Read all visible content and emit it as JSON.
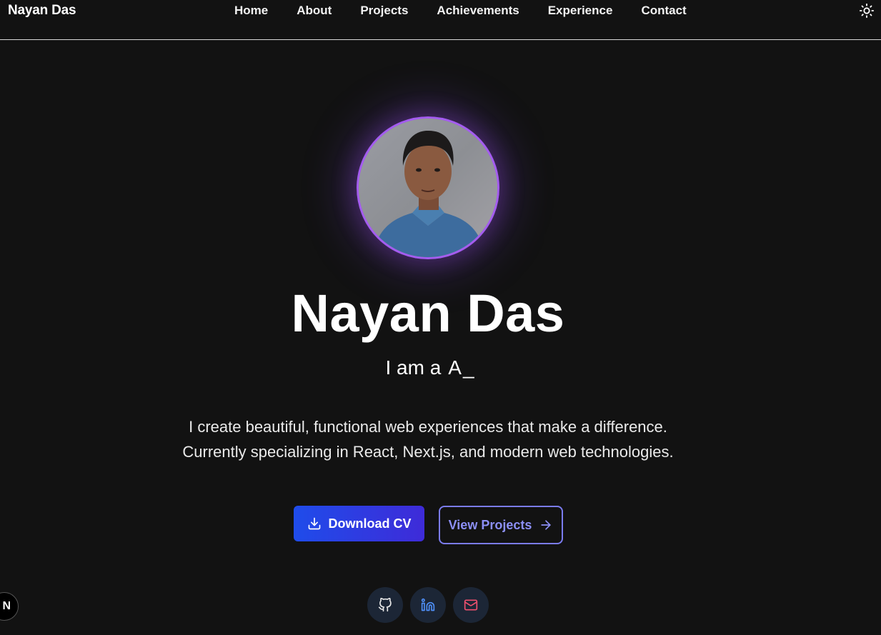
{
  "nav": {
    "brand": "Nayan Das",
    "links": [
      "Home",
      "About",
      "Projects",
      "Achievements",
      "Experience",
      "Contact"
    ],
    "theme_icon": "sun-icon"
  },
  "hero": {
    "avatar_alt": "profile-photo",
    "name": "Nayan Das",
    "typing_prefix": "I am a",
    "typing_text": "A",
    "typing_cursor": "_",
    "bio_line1": "I create beautiful, functional web experiences that make a difference.",
    "bio_line2": "Currently specializing in React, Next.js, and modern web technologies.",
    "download_label": "Download CV",
    "download_icon": "download-icon",
    "projects_label": "View Projects",
    "projects_icon": "arrow-right-icon"
  },
  "socials": [
    {
      "name": "github",
      "icon": "github-icon",
      "color": "#e6e6e6"
    },
    {
      "name": "linkedin",
      "icon": "linkedin-icon",
      "color": "#4f8ff7"
    },
    {
      "name": "email",
      "icon": "mail-icon",
      "color": "#f0506e"
    }
  ],
  "corner_badge": "N",
  "colors": {
    "background": "#121212",
    "accent_primary": "#1f4cea",
    "accent_secondary": "#7b7cf0",
    "avatar_ring": "#a45cf0"
  }
}
